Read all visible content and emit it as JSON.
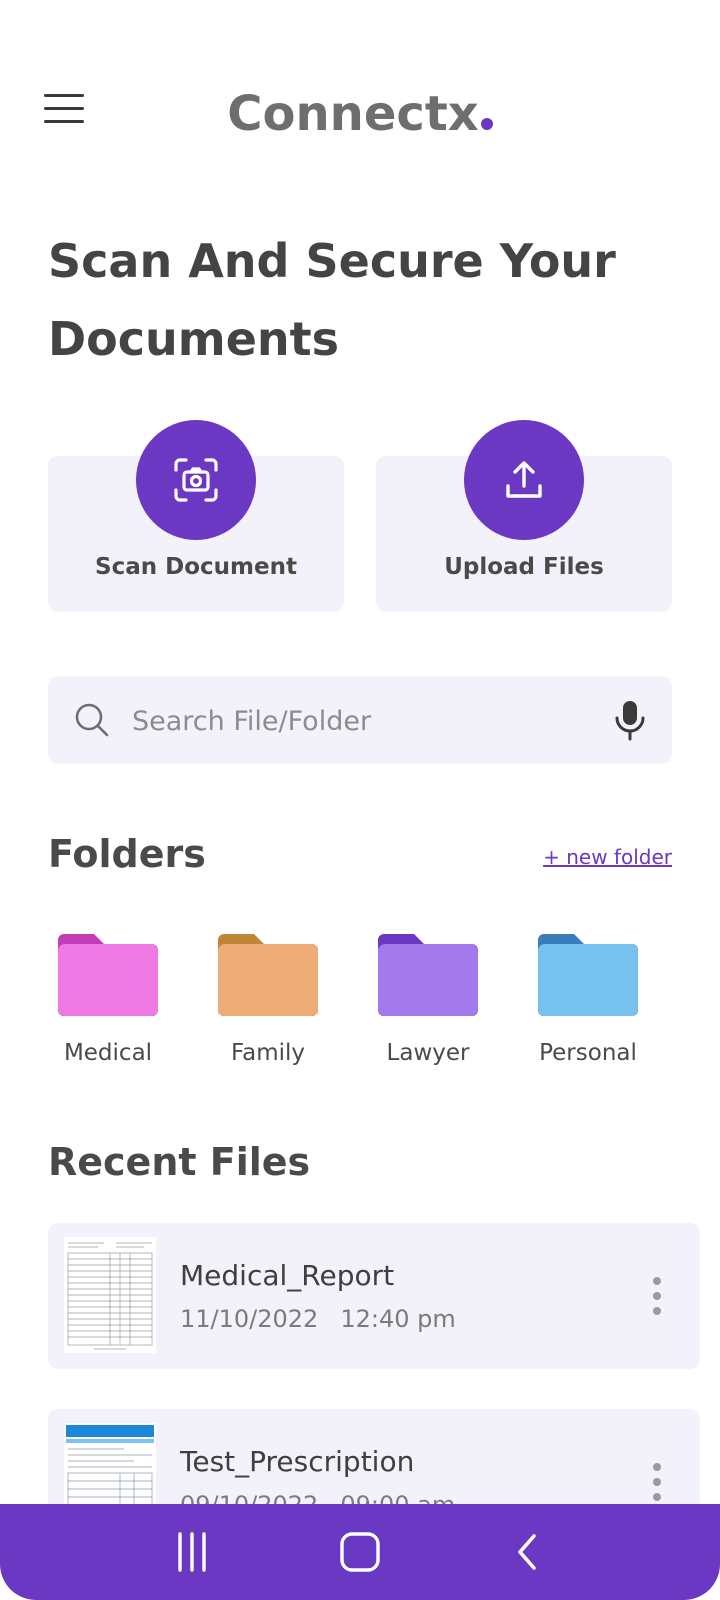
{
  "header": {
    "logo_text": "Connectx",
    "logo_dot_color": "#6a38c2"
  },
  "headline": "Scan And Secure Your Documents",
  "actions": [
    {
      "label": "Scan Document",
      "icon": "camera-scan-icon"
    },
    {
      "label": "Upload Files",
      "icon": "upload-icon"
    }
  ],
  "search": {
    "placeholder": "Search File/Folder",
    "value": ""
  },
  "folders": {
    "title": "Folders",
    "new_folder_label": "+ new folder",
    "items": [
      {
        "label": "Medical",
        "color": "#ef7ae3",
        "tab_color": "#c53cb8"
      },
      {
        "label": "Family",
        "color": "#eead76",
        "tab_color": "#c08638"
      },
      {
        "label": "Lawyer",
        "color": "#a37aec",
        "tab_color": "#6a38c2"
      },
      {
        "label": "Personal",
        "color": "#77c1ee",
        "tab_color": "#3a7dbd"
      }
    ]
  },
  "recent": {
    "title": "Recent Files",
    "files": [
      {
        "name": "Medical_Report",
        "date": "11/10/2022",
        "time": "12:40 pm"
      },
      {
        "name": "Test_Prescription",
        "date": "09/10/2022",
        "time": "09:00 am"
      }
    ]
  },
  "colors": {
    "accent": "#6a38c2",
    "card_bg": "#f3f2fa",
    "text": "#444444"
  }
}
